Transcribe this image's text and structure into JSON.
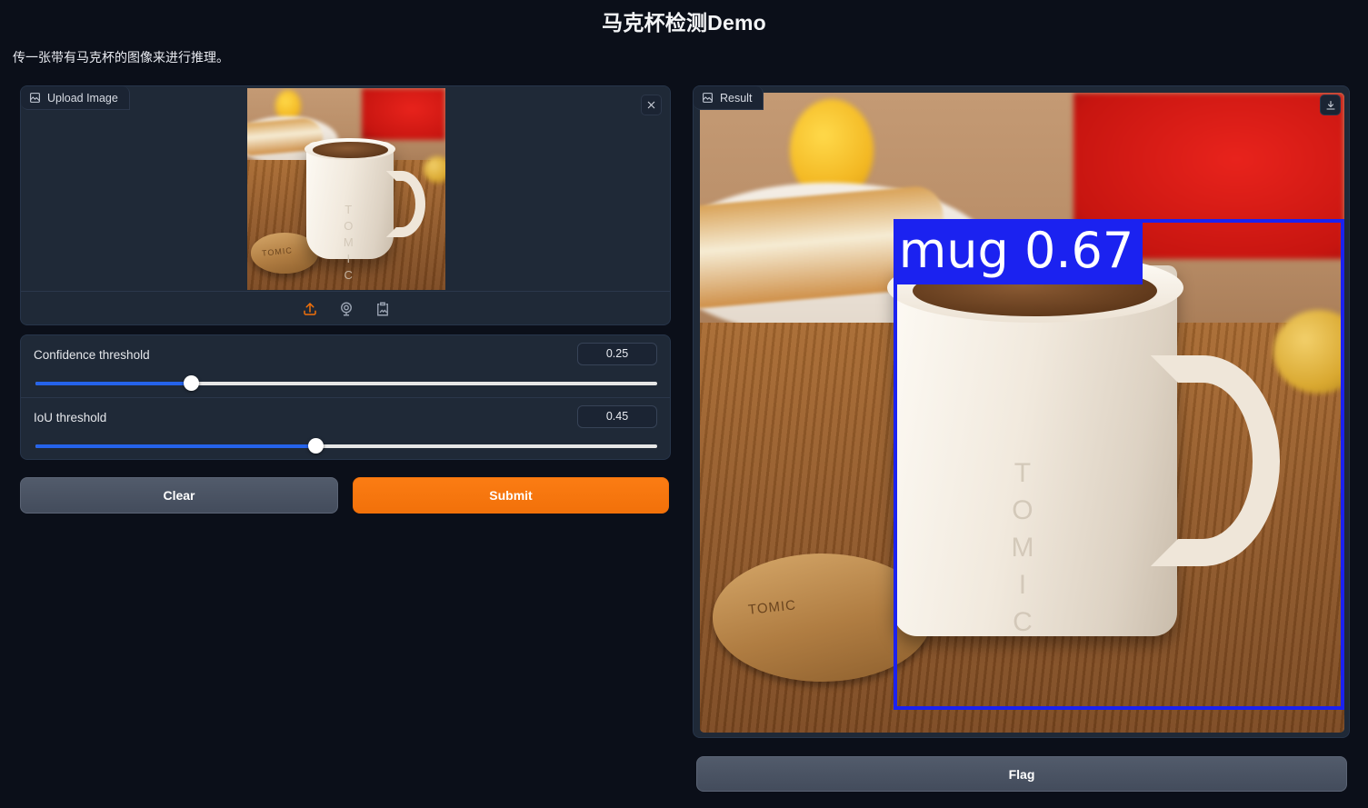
{
  "app": {
    "title": "马克杯检测Demo",
    "subtitle": "传一张带有马克杯的图像来进行推理。"
  },
  "upload": {
    "tab_label": "Upload Image",
    "tab_icon": "image-icon",
    "close_icon": "close-icon",
    "tools": [
      {
        "name": "upload-icon",
        "label": "Upload"
      },
      {
        "name": "webcam-icon",
        "label": "Webcam"
      },
      {
        "name": "paste-clipboard-icon",
        "label": "Paste from clipboard"
      }
    ],
    "thumbnail_alt": "白色马克杯照片",
    "mug_brand_text": "TOMIC",
    "lid_brand_text": "TOMIC"
  },
  "sliders": [
    {
      "name": "confidence-threshold",
      "label": "Confidence threshold",
      "value": "0.25",
      "percent": 25,
      "min": 0,
      "max": 1
    },
    {
      "name": "iou-threshold",
      "label": "IoU threshold",
      "value": "0.45",
      "percent": 45,
      "min": 0,
      "max": 1
    }
  ],
  "actions": {
    "clear_label": "Clear",
    "submit_label": "Submit",
    "flag_label": "Flag"
  },
  "result": {
    "tab_label": "Result",
    "tab_icon": "image-icon",
    "download_icon": "download-icon",
    "detections": [
      {
        "label": "mug",
        "score": "0.67",
        "label_text": "mug 0.67",
        "box_color": "#1b22f0",
        "box": {
          "left_pct": 30.0,
          "top_pct": 19.7,
          "width_pct": 70.0,
          "height_pct": 76.7
        }
      }
    ],
    "mug_brand_text": "TOMIC",
    "lid_brand_text": "TOMIC"
  },
  "colors": {
    "background": "#0b0f19",
    "panel": "#1f2937",
    "accent_orange": "#f2710a",
    "slider_blue": "#2563eb",
    "box_blue": "#1b22f0",
    "button_gray": "#4a5362"
  }
}
